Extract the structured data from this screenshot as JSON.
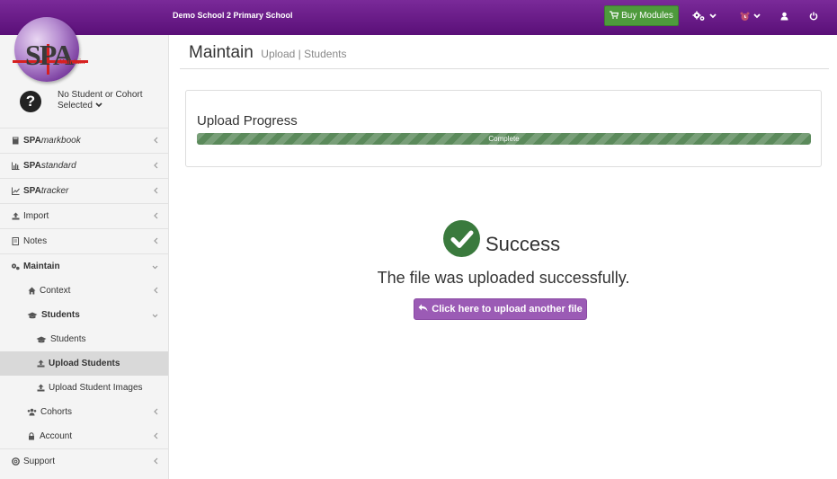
{
  "header": {
    "school_name": "Demo School 2 Primary School",
    "buy_modules_label": "Buy Modules",
    "colors": {
      "bar": "#5a0f78",
      "buy": "#4e9a3c"
    },
    "icons": [
      "cart-icon",
      "settings-icon",
      "alarm-icon",
      "user-icon",
      "power-icon"
    ]
  },
  "logo": {
    "text": "SPA",
    "subtitle": "Maintain"
  },
  "cohort": {
    "line1": "No Student or Cohort",
    "line2": "Selected"
  },
  "sidebar": {
    "items": [
      {
        "prefix": "SPA",
        "suffix": "markbook",
        "icon": "book-icon"
      },
      {
        "prefix": "SPA",
        "suffix": "standard",
        "icon": "bar-chart-icon"
      },
      {
        "prefix": "SPA",
        "suffix": "tracker",
        "icon": "line-chart-icon"
      },
      {
        "label": "Import",
        "icon": "upload-icon"
      },
      {
        "label": "Notes",
        "icon": "notes-icon"
      },
      {
        "label": "Maintain",
        "icon": "cogs-icon"
      },
      {
        "label": "Context",
        "icon": "home-icon"
      },
      {
        "label": "Students",
        "icon": "graduation-cap-icon"
      },
      {
        "label": "Students",
        "icon": "graduation-cap-icon"
      },
      {
        "label": "Upload Students",
        "icon": "upload-icon"
      },
      {
        "label": "Upload Student Images",
        "icon": "upload-icon"
      },
      {
        "label": "Cohorts",
        "icon": "users-icon"
      },
      {
        "label": "Account",
        "icon": "lock-icon"
      },
      {
        "label": "Support",
        "icon": "life-ring-icon"
      }
    ]
  },
  "page": {
    "title": "Maintain",
    "subtitle": "Upload | Students"
  },
  "upload": {
    "title": "Upload Progress",
    "status": "Complete",
    "progress": 1.0,
    "bar_color": "#5b8a5b"
  },
  "result": {
    "heading": "Success",
    "message": "The file was uploaded successfully.",
    "button_label": "Click here to upload another file",
    "colors": {
      "check": "#3a7a3d",
      "button": "#9b5bb5"
    }
  }
}
